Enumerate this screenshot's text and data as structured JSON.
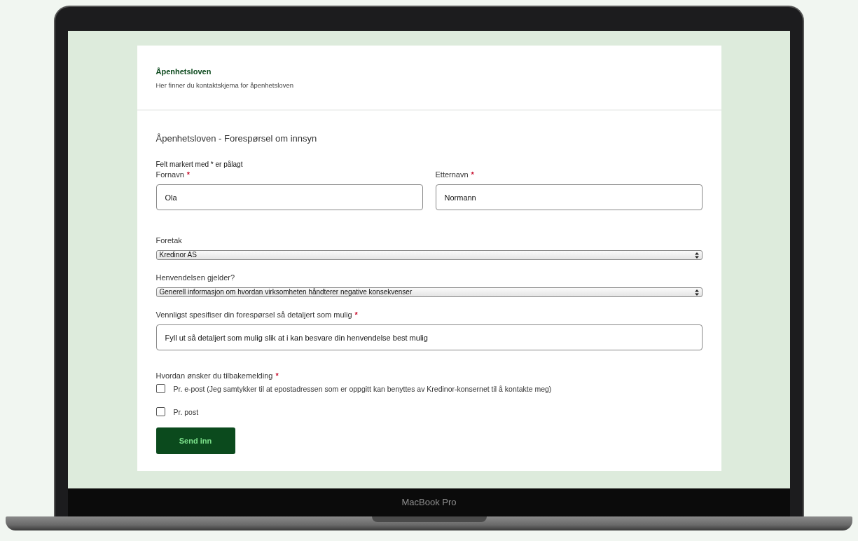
{
  "header": {
    "title": "Åpenhetsloven",
    "subtitle": "Her finner du kontaktskjema for åpenhetsloven"
  },
  "form": {
    "title": "Åpenhetsloven - Forespørsel om innsyn",
    "required_note": "Felt markert med * er pålagt",
    "name_fields": [
      {
        "kind": "text",
        "label": "Fornavn",
        "required_mark": "*",
        "value": "Ola"
      },
      {
        "kind": "text",
        "label": "Etternavn",
        "required_mark": "*",
        "value": "Normann"
      }
    ],
    "fields": [
      {
        "kind": "select",
        "label": "Foretak",
        "value": "Kredinor AS"
      },
      {
        "kind": "select",
        "label": "Henvendelsen gjelder?",
        "value": "Generell informasjon om hvordan virksomheten håndterer negative konsekvenser"
      },
      {
        "kind": "text",
        "label": "Vennligst spesifiser din forespørsel så detaljert som mulig",
        "required_mark": "*",
        "value": "Fyll ut så detaljert som mulig slik at i kan besvare din henvendelse best mulig"
      }
    ],
    "feedback": {
      "label": "Hvordan ønsker du tilbakemelding",
      "required_mark": "*",
      "options": [
        {
          "label": "Pr. e-post (Jeg samtykker til at epostadressen som er oppgitt kan benyttes av Kredinor-konsernet til å kontakte meg)",
          "checked": false
        },
        {
          "label": "Pr. post",
          "checked": false
        }
      ]
    },
    "submit": "Send inn"
  },
  "device_label": "MacBook Pro"
}
